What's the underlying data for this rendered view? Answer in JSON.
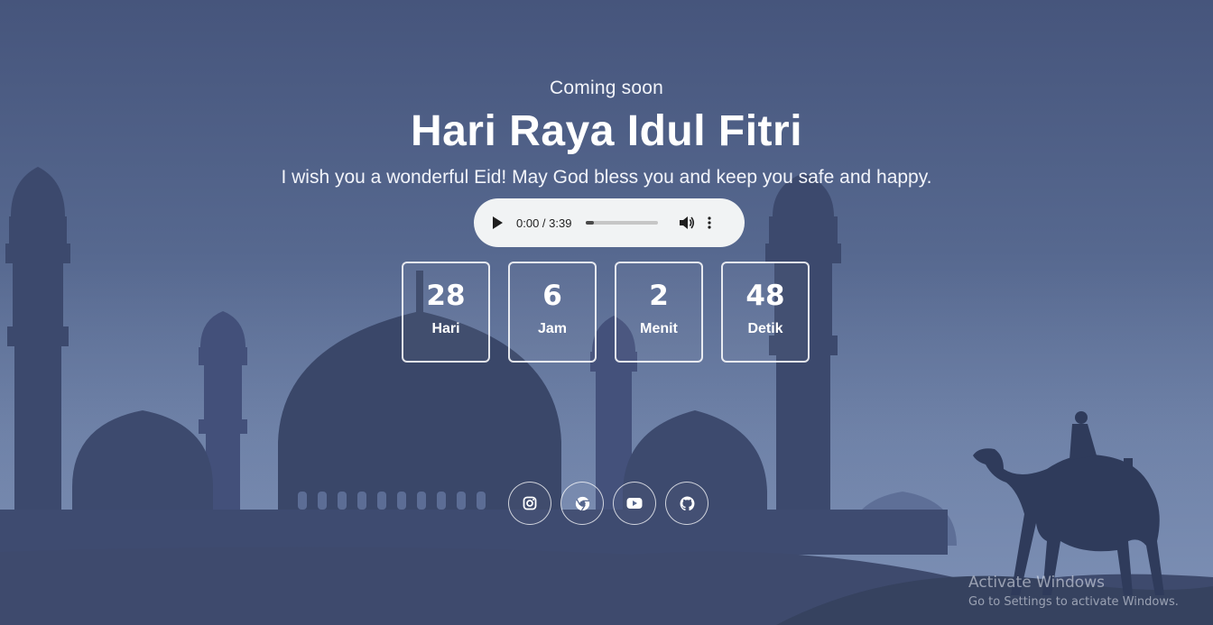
{
  "hero": {
    "eyebrow": "Coming soon",
    "title": "Hari Raya Idul Fitri",
    "subtitle": "I wish you a wonderful Eid! May God bless you and keep you safe and happy."
  },
  "audio_player": {
    "time_display": "0:00 / 3:39",
    "progress_fraction": 0.0
  },
  "countdown": [
    {
      "value": "28",
      "label": "Hari"
    },
    {
      "value": "6",
      "label": "Jam"
    },
    {
      "value": "2",
      "label": "Menit"
    },
    {
      "value": "48",
      "label": "Detik"
    }
  ],
  "social_links": [
    {
      "icon": "instagram-icon"
    },
    {
      "icon": "chrome-icon"
    },
    {
      "icon": "youtube-icon"
    },
    {
      "icon": "github-icon"
    }
  ],
  "os_watermark": {
    "line1": "Activate Windows",
    "line2": "Go to Settings to activate Windows."
  },
  "colors": {
    "background_top": "#46557c",
    "background_bottom": "#7a8db2",
    "silhouette": "#3d4a6e",
    "player_bg": "#f1f3f4",
    "text": "#ffffff"
  }
}
